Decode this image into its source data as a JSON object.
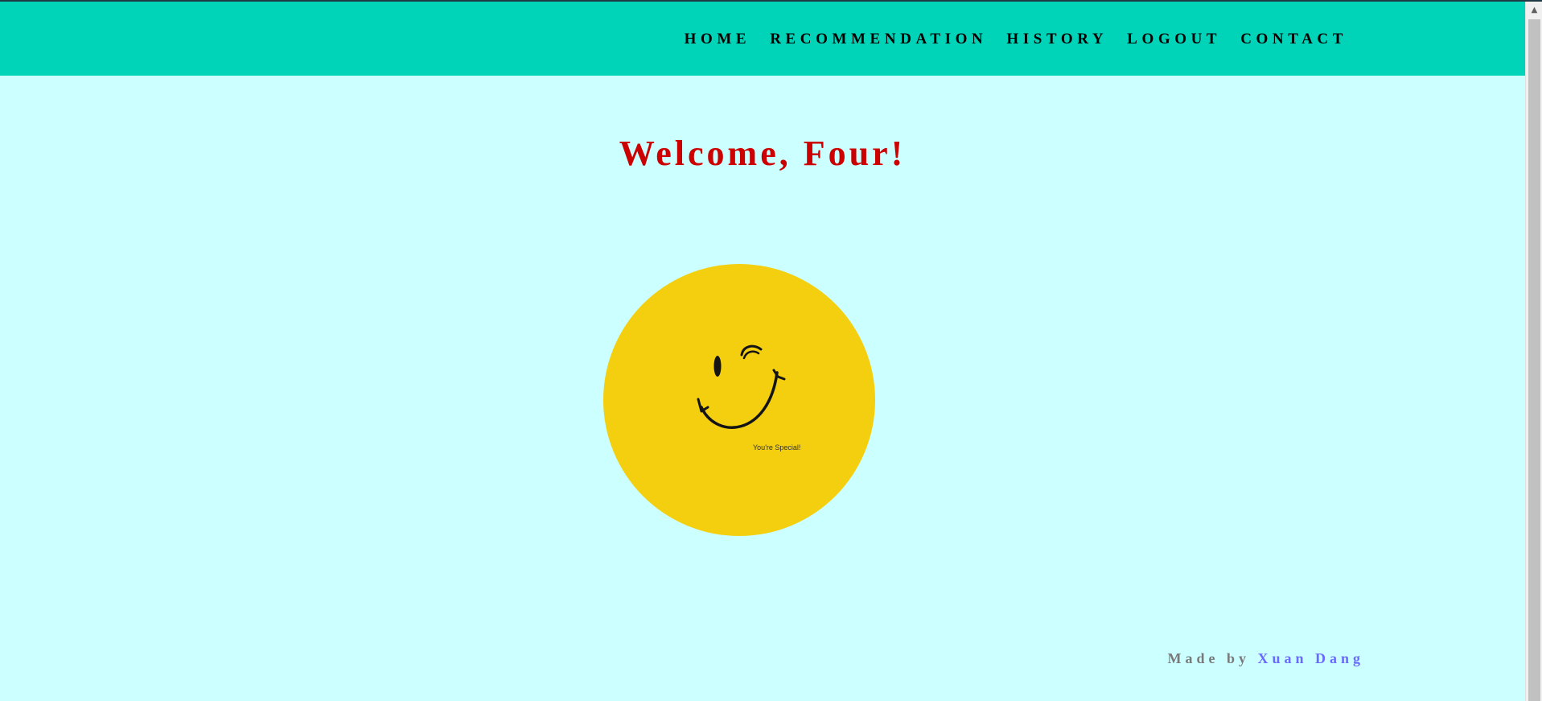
{
  "nav": {
    "items": [
      {
        "label": "HOME"
      },
      {
        "label": "RECOMMENDATION"
      },
      {
        "label": "HISTORY"
      },
      {
        "label": "LOGOUT"
      },
      {
        "label": "CONTACT"
      }
    ]
  },
  "main": {
    "welcome": "Welcome, Four!",
    "smiley_caption": "You're Special!"
  },
  "footer": {
    "made_by": "Made by ",
    "author": "Xuan Dang"
  },
  "colors": {
    "navbar_bg": "#00d4b8",
    "page_bg": "#ccffff",
    "welcome_text": "#cc0000",
    "smiley_face": "#f4cf10",
    "author_link": "#6a6aff"
  },
  "icons": {
    "smiley": "winking-smiley-face",
    "scroll_up": "scroll-up-arrow-icon"
  }
}
